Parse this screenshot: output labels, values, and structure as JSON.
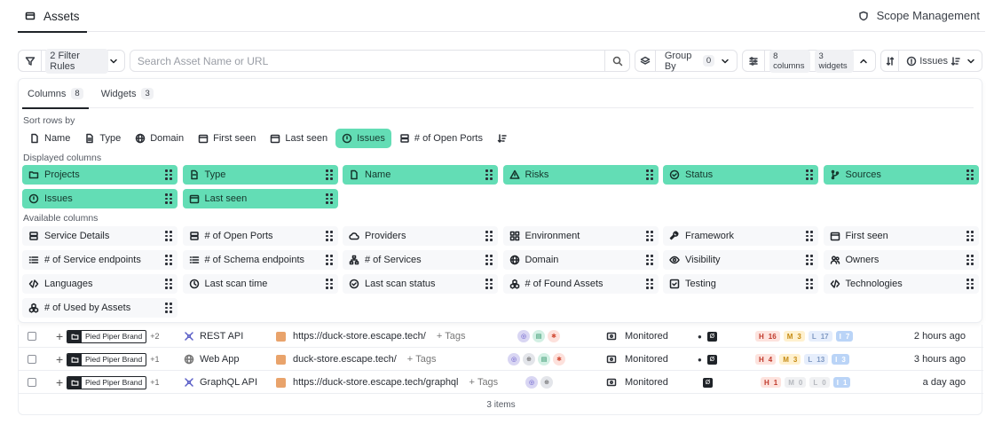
{
  "header": {
    "tab_label": "Assets",
    "scope_label": "Scope Management"
  },
  "toolbar": {
    "filter_label": "2 Filter Rules",
    "search_placeholder": "Search Asset Name or URL",
    "groupby_label": "Group By",
    "groupby_count": "0",
    "columns_chip": "8 columns",
    "widgets_chip": "3 widgets",
    "sort_label": "Issues"
  },
  "panel": {
    "tabs": [
      {
        "label": "Columns",
        "count": "8"
      },
      {
        "label": "Widgets",
        "count": "3"
      }
    ],
    "sort_rows_label": "Sort rows by",
    "sort_options": [
      "Name",
      "Type",
      "Domain",
      "First seen",
      "Last seen",
      "Issues",
      "# of Open Ports"
    ],
    "displayed_label": "Displayed columns",
    "displayed": [
      "Projects",
      "Type",
      "Name",
      "Risks",
      "Status",
      "Sources",
      "Issues",
      "Last seen"
    ],
    "available_label": "Available columns",
    "available": [
      "Service Details",
      "# of Open Ports",
      "Providers",
      "Environment",
      "Framework",
      "First seen",
      "# of Service endpoints",
      "# of Schema endpoints",
      "# of Services",
      "Domain",
      "Visibility",
      "Owners",
      "Languages",
      "Last scan time",
      "Last scan status",
      "# of Found Assets",
      "Testing",
      "Technologies",
      "# of Used by Assets"
    ]
  },
  "rows": [
    {
      "brand": "Pied Piper Brand",
      "more": "+2",
      "type": "REST API",
      "url": "https://duck-store.escape.tech/",
      "tags": "Tags",
      "status": "Monitored",
      "h": "H",
      "hv": "16",
      "m": "M",
      "mv": "3",
      "l": "L",
      "lv": "17",
      "i": "I",
      "iv": "7",
      "when": "2 hours ago"
    },
    {
      "brand": "Pied Piper Brand",
      "more": "+1",
      "type": "Web App",
      "url": "duck-store.escape.tech/",
      "tags": "Tags",
      "status": "Monitored",
      "h": "H",
      "hv": "4",
      "m": "M",
      "mv": "3",
      "l": "L",
      "lv": "13",
      "i": "I",
      "iv": "3",
      "when": "3 hours ago"
    },
    {
      "brand": "Pied Piper Brand",
      "more": "+1",
      "type": "GraphQL API",
      "url": "https://duck-store.escape.tech/graphql",
      "tags": "Tags",
      "status": "Monitored",
      "h": "H",
      "hv": "1",
      "m": "M",
      "mv": "0",
      "l": "L",
      "lv": "0",
      "i": "I",
      "iv": "1",
      "when": "a day ago"
    }
  ],
  "footer": {
    "count": "3 items"
  }
}
